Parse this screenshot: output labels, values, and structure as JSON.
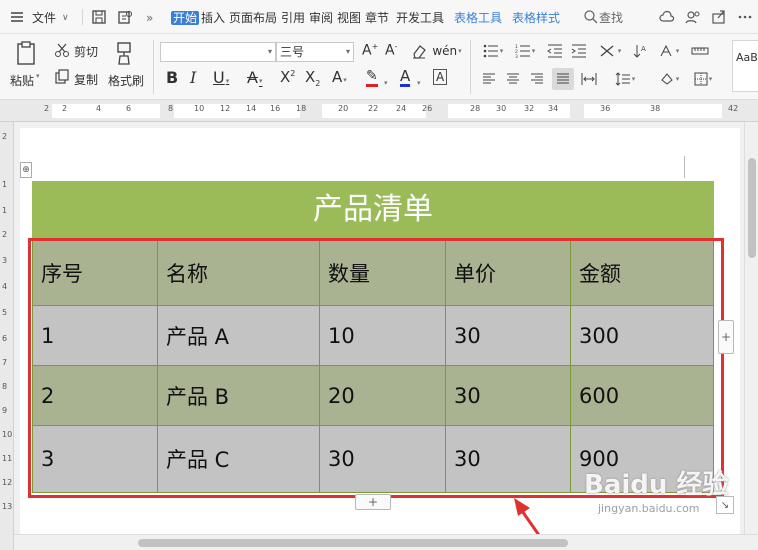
{
  "menubar": {
    "file": "文件",
    "tabs": [
      "开始",
      "插入",
      "页面布局",
      "引用",
      "审阅",
      "视图",
      "章节",
      "开发工具"
    ],
    "context_tabs": [
      "表格工具",
      "表格样式"
    ],
    "search": "查找"
  },
  "ribbon": {
    "paste": "粘贴",
    "cut": "剪切",
    "copy": "复制",
    "format_painter": "格式刷",
    "font_size": "三号",
    "style_preview": "AaB"
  },
  "ruler": {
    "numbers": [
      "2",
      "2",
      "4",
      "6",
      "8",
      "10",
      "12",
      "14",
      "16",
      "18",
      "20",
      "22",
      "24",
      "26",
      "28",
      "30",
      "32",
      "34",
      "36",
      "38",
      "42"
    ],
    "vnumbers": [
      "2",
      "1",
      "1",
      "2",
      "3",
      "4",
      "5",
      "6",
      "7",
      "8",
      "9",
      "10",
      "11",
      "12",
      "13"
    ]
  },
  "document": {
    "title": "产品清单",
    "table": {
      "headers": [
        "序号",
        "名称",
        "数量",
        "单价",
        "金额"
      ],
      "rows": [
        [
          "1",
          "产品 A",
          "10",
          "30",
          "300"
        ],
        [
          "2",
          "产品 B",
          "20",
          "30",
          "600"
        ],
        [
          "3",
          "产品 C",
          "30",
          "30",
          "900"
        ]
      ]
    },
    "add_row": "+",
    "add_col": "+"
  },
  "colors": {
    "title_bg": "#9bbb59",
    "header_bg": "#a9b291",
    "row_gray": "#c3c3c3",
    "highlight": "#e0302f",
    "accent": "#3a7fd5"
  },
  "watermark": {
    "logo": "Baidu 经验",
    "url": "jingyan.baidu.com"
  }
}
